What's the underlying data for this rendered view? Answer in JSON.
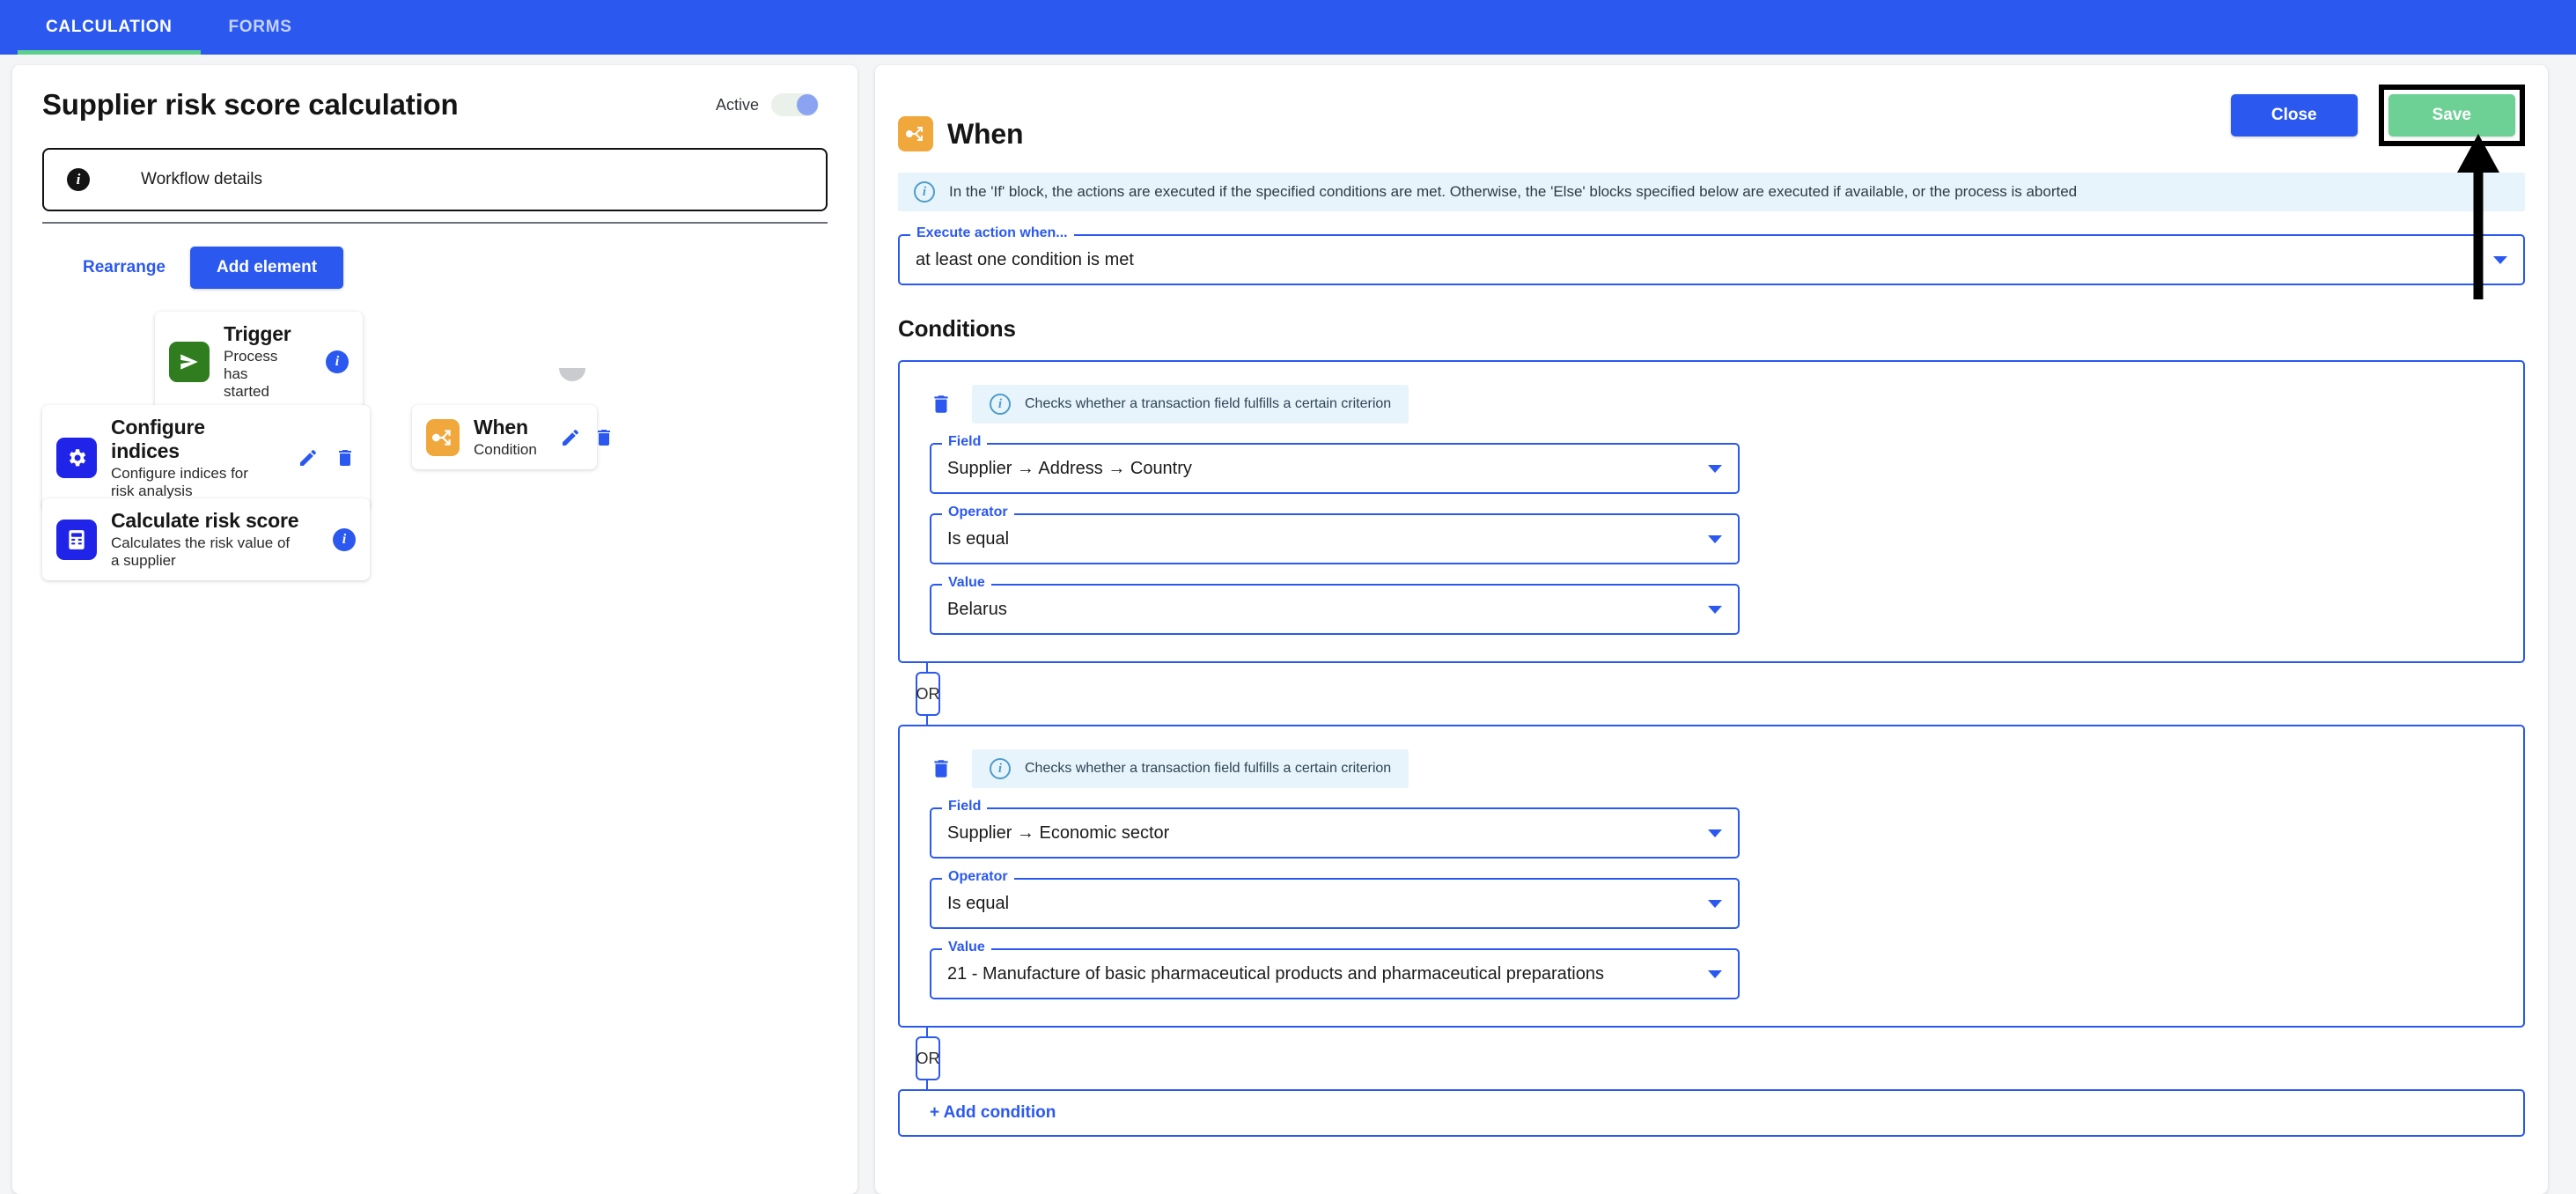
{
  "topbar": {
    "tabs": [
      {
        "label": "CALCULATION",
        "active": true
      },
      {
        "label": "FORMS",
        "active": false
      }
    ]
  },
  "left_panel": {
    "title": "Supplier risk score calculation",
    "active_label": "Active",
    "active_state": "on",
    "workflow_details_label": "Workflow details",
    "rearrange_label": "Rearrange",
    "add_element_label": "Add element",
    "nodes": [
      {
        "title": "Trigger",
        "subtitle": "Process has started",
        "icon": "send-icon",
        "icon_color": "#2f7d1f",
        "actions": [
          "info-badge"
        ]
      },
      {
        "title": "Configure indices",
        "subtitle": "Configure indices for risk analysis",
        "icon": "gear-icon",
        "icon_color": "#1f24e8",
        "actions": [
          "edit-icon",
          "trash-icon"
        ]
      },
      {
        "title": "Calculate risk score",
        "subtitle": "Calculates the risk value of a supplier",
        "icon": "calculator-icon",
        "icon_color": "#1f24e8",
        "actions": [
          "info-badge"
        ]
      },
      {
        "title": "When",
        "subtitle": "Condition",
        "icon": "branch-icon",
        "icon_color": "#f0a83c",
        "actions": [
          "edit-icon",
          "trash-icon"
        ]
      }
    ]
  },
  "right_panel": {
    "title": "When",
    "title_icon": "branch-icon",
    "close_label": "Close",
    "save_label": "Save",
    "save_highlighted": true,
    "info_banner": "In the 'If' block, the actions are executed if the specified conditions are met. Otherwise, the 'Else' blocks specified below are executed if available, or the process is aborted",
    "execute_when": {
      "label": "Execute action when...",
      "value": "at least one condition is met"
    },
    "conditions_heading": "Conditions",
    "condition_chip_text": "Checks whether a transaction field fulfills a certain criterion",
    "field_labels": {
      "field": "Field",
      "operator": "Operator",
      "value": "Value"
    },
    "conditions": [
      {
        "field": "Supplier → Address → Country",
        "operator": "Is equal",
        "value": "Belarus"
      },
      {
        "field": "Supplier → Economic sector",
        "operator": "Is equal",
        "value": "21 - Manufacture of basic pharmaceutical products and pharmaceutical preparations"
      }
    ],
    "or_label": "OR",
    "add_condition_label": "+ Add condition"
  },
  "colors": {
    "brand_blue": "#2b59f0",
    "accent_green": "#5ccf8e",
    "save_green": "#6dd195",
    "orange": "#f0a83c",
    "info_bg": "#e8f4fb"
  }
}
